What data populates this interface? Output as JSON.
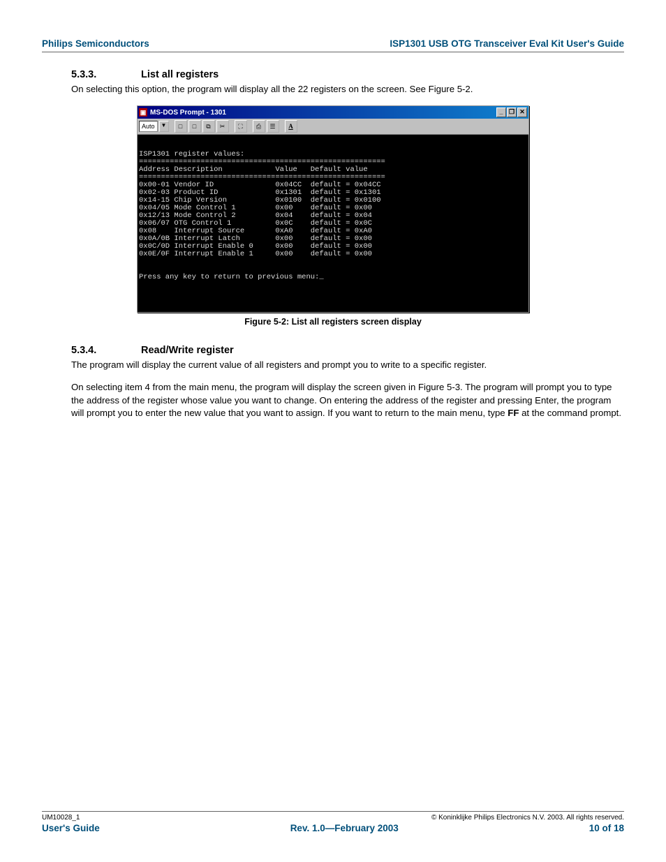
{
  "header": {
    "left": "Philips Semiconductors",
    "right": "ISP1301 USB OTG Transceiver Eval Kit User's Guide"
  },
  "sec1": {
    "num": "5.3.3.",
    "title": "List all registers",
    "para": "On selecting this option, the program will display all the 22 registers on the screen. See Figure 5-2."
  },
  "dos": {
    "title": "MS-DOS Prompt - 1301",
    "auto": "Auto",
    "glyphs": [
      "□",
      "□",
      "⧉",
      "✂",
      "⛶",
      "⎙",
      "☰",
      "A"
    ],
    "minimize": "_",
    "maximize": "❐",
    "close": "✕",
    "body": "\n\nISP1301 register values:\n========================================================\nAddress Description            Value   Default value\n========================================================\n0x00-01 Vendor ID              0x04CC  default = 0x04CC\n0x02-03 Product ID             0x1301  default = 0x1301\n0x14-15 Chip Version           0x0100  default = 0x0100\n0x04/05 Mode Control 1         0x00    default = 0x00\n0x12/13 Mode Control 2         0x04    default = 0x04\n0x06/07 OTG Control 1          0x0C    default = 0x0C\n0x08    Interrupt Source       0xA0    default = 0xA0\n0x0A/0B Interrupt Latch        0x00    default = 0x00\n0x0C/0D Interrupt Enable 0     0x00    default = 0x00\n0x0E/0F Interrupt Enable 1     0x00    default = 0x00\n\n\nPress any key to return to previous menu:_\n\n\n\n\n"
  },
  "caption": "Figure 5-2: List all registers screen display",
  "sec2": {
    "num": "5.3.4.",
    "title": "Read/Write register",
    "para1": "The program will display the current value of all registers and prompt you to write to a specific register.",
    "para2a": "On selecting item 4 from the main menu, the program will display the screen given in Figure 5-3. The program will prompt you to type the address of the register whose value you want to change. On entering the address of the register and pressing Enter, the program will prompt you to enter the new value that you want to assign. If you want to return to the main menu, type ",
    "para2bold": "FF",
    "para2b": " at the command prompt."
  },
  "footer": {
    "docid": "UM10028_1",
    "copyright": "© Koninklijke Philips Electronics N.V. 2003. All rights reserved.",
    "left": "User's Guide",
    "center": "Rev. 1.0—February 2003",
    "right": "10 of 18"
  }
}
